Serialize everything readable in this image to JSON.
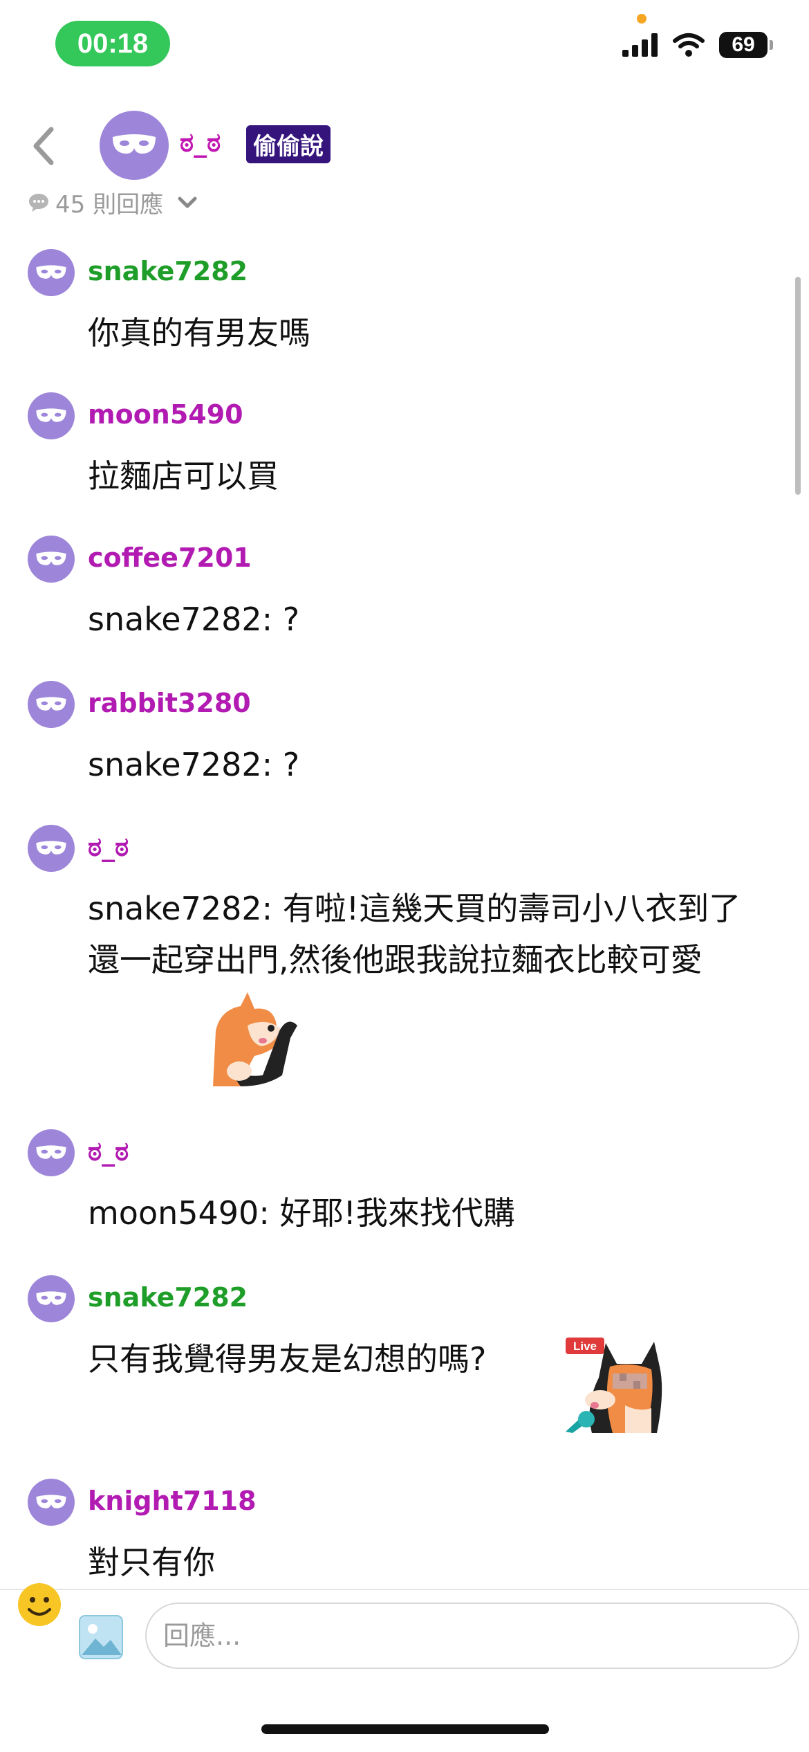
{
  "status_bar": {
    "time": "00:18",
    "battery": "69"
  },
  "header": {
    "author": "ಠ_ಠ",
    "tag": "偷偷說",
    "reply_count": "45 則回應"
  },
  "comments": [
    {
      "user": "snake7282",
      "user_color": "#1e9e28",
      "text": "你真的有男友嗎"
    },
    {
      "user": "moon5490",
      "user_color": "#b21bb2",
      "text": "拉麵店可以買"
    },
    {
      "user": "coffee7201",
      "user_color": "#b21bb2",
      "text": "snake7282: ?"
    },
    {
      "user": "rabbit3280",
      "user_color": "#b21bb2",
      "text": "snake7282: ?"
    },
    {
      "user": "ಠ_ಠ",
      "user_color": "#b21bb2",
      "text": "snake7282: 有啦!這幾天買的壽司小八衣到了還一起穿出門,然後他跟我說拉麵衣比較可愛"
    },
    {
      "user": "ಠ_ಠ",
      "user_color": "#b21bb2",
      "text": "moon5490: 好耶!我來找代購"
    },
    {
      "user": "snake7282",
      "user_color": "#1e9e28",
      "text": "只有我覺得男友是幻想的嗎?"
    },
    {
      "user": "knight7118",
      "user_color": "#b21bb2",
      "text": "對只有你"
    }
  ],
  "stickers": {
    "live_badge": "Live"
  },
  "reply_bar": {
    "placeholder": "回應..."
  }
}
